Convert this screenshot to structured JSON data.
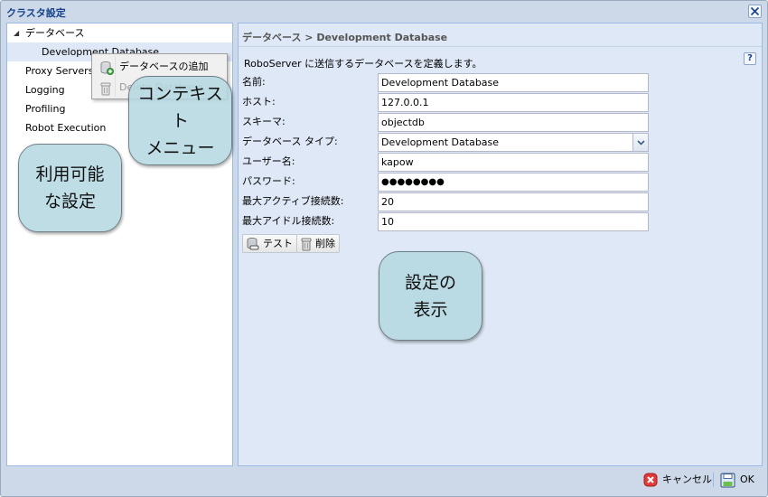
{
  "window": {
    "title": "クラスタ設定"
  },
  "tree": {
    "root": {
      "label": "データベース",
      "expanded": true
    },
    "children": [
      {
        "label": "Development Database",
        "selected": true
      }
    ],
    "items": [
      {
        "label": "Proxy Servers"
      },
      {
        "label": "Logging"
      },
      {
        "label": "Profiling"
      },
      {
        "label": "Robot Execution"
      }
    ]
  },
  "context_menu": {
    "items": [
      {
        "label": "データベースの追加",
        "icon": "database-add-icon",
        "enabled": true
      },
      {
        "label": "Delete Database",
        "icon": "trash-icon",
        "enabled": false
      }
    ]
  },
  "main": {
    "breadcrumb": "データベース > Development Database",
    "description": "RoboServer に送信するデータベースを定義します。",
    "form": {
      "name_label": "名前:",
      "name_value": "Development Database",
      "host_label": "ホスト:",
      "host_value": "127.0.0.1",
      "schema_label": "スキーマ:",
      "schema_value": "objectdb",
      "dbtype_label": "データベース タイプ:",
      "dbtype_value": "Development Database",
      "user_label": "ユーザー名:",
      "user_value": "kapow",
      "password_label": "パスワード:",
      "password_value": "●●●●●●●●",
      "max_active_label": "最大アクティブ接続数:",
      "max_active_value": "20",
      "max_idle_label": "最大アイドル接続数:",
      "max_idle_value": "10"
    },
    "buttons": {
      "test": "テスト",
      "delete": "削除"
    }
  },
  "footer": {
    "cancel": "キャンセル",
    "ok": "OK"
  },
  "callouts": {
    "context_menu": [
      "コンテキスト",
      "メニュー"
    ],
    "available_settings": [
      "利用可能",
      "な設定"
    ],
    "settings_display": [
      "設定の",
      "表示"
    ]
  },
  "colors": {
    "title_text": "#15428b",
    "panel_border": "#99bbe8",
    "panel_bg": "#dfe8f6",
    "callout_bg": "#b4d7e1"
  }
}
